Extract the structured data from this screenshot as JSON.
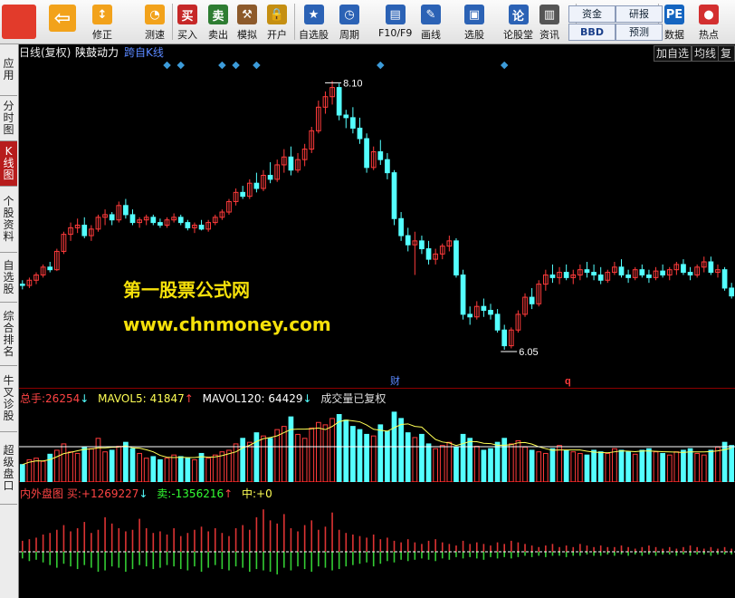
{
  "toolbar": {
    "buttons": [
      {
        "label": "",
        "icon": "grid-logo-icon",
        "color": "#e23b2b",
        "sym": ""
      },
      {
        "label": "",
        "icon": "back-arrow-icon",
        "color": "#f2a21b",
        "sym": "⇦"
      },
      {
        "label": "修正",
        "icon": "fix-icon",
        "color": "#f2a21b",
        "sym": "↕"
      },
      {
        "label": "测速",
        "icon": "speed-test-icon",
        "color": "#f2a21b",
        "sym": "◔"
      },
      {
        "label": "买入",
        "icon": "buy-icon",
        "color": "#c62828",
        "sym": "买"
      },
      {
        "label": "卖出",
        "icon": "sell-icon",
        "color": "#2e7d32",
        "sym": "卖"
      },
      {
        "label": "模拟",
        "icon": "simulate-icon",
        "color": "#8d5a2b",
        "sym": "⚒"
      },
      {
        "label": "开户",
        "icon": "lock-icon",
        "color": "#c58f12",
        "sym": "🔒"
      },
      {
        "label": "自选股",
        "icon": "star-watchlist-icon",
        "color": "#2b62b5",
        "sym": "★"
      },
      {
        "label": "周期",
        "icon": "period-icon",
        "color": "#2b62b5",
        "sym": "◷"
      },
      {
        "label": "F10/F9",
        "icon": "f10-info-icon",
        "color": "#2b62b5",
        "sym": "▤"
      },
      {
        "label": "画线",
        "icon": "draw-line-icon",
        "color": "#2b62b5",
        "sym": "✎"
      },
      {
        "label": "选股",
        "icon": "stock-picker-icon",
        "color": "#2b62b5",
        "sym": "▣"
      },
      {
        "label": "论股堂",
        "icon": "forum-icon",
        "color": "#2b62b5",
        "sym": "论"
      },
      {
        "label": "资讯",
        "icon": "news-icon",
        "color": "#555555",
        "sym": "▥"
      },
      {
        "label": "数据",
        "icon": "pe-data-icon",
        "color": "#1565c0",
        "sym": "PE"
      },
      {
        "label": "热点",
        "icon": "hot-icon",
        "color": "#d32f2f",
        "sym": "●"
      }
    ],
    "pills": [
      "资金",
      "研报",
      "BBD",
      "预测"
    ]
  },
  "sidebar": {
    "tabs": [
      {
        "label": "应用",
        "name": "sidebar-tab-apps"
      },
      {
        "label": "分时图",
        "name": "sidebar-tab-intraday"
      },
      {
        "label": "K线图",
        "name": "sidebar-tab-kline"
      },
      {
        "label": "个股资料",
        "name": "sidebar-tab-stock-profile"
      },
      {
        "label": "自选股",
        "name": "sidebar-tab-watchlist"
      },
      {
        "label": "综合排名",
        "name": "sidebar-tab-ranking"
      },
      {
        "label": "牛叉诊股",
        "name": "sidebar-tab-diagnosis"
      },
      {
        "label": "超级盘口",
        "name": "sidebar-tab-super-quote"
      }
    ],
    "active": 2
  },
  "chart_header": {
    "period": "日线(复权)",
    "stock_name": "陕鼓动力",
    "indicator": "跨自K线",
    "btn_add_watch": "加自选",
    "btn_ma": "均线",
    "btn_restore": "复权"
  },
  "annotations": {
    "high_label": "8.10",
    "low_label": "6.05",
    "cai_marker": "财",
    "q_marker": "q"
  },
  "volume_panel": {
    "total_label": "总手:",
    "total_value": "26254",
    "mavol5_label": "MAVOL5:",
    "mavol5_value": "41847",
    "mavol120_label": "MAVOL120:",
    "mavol120_value": "64429",
    "note": "成交量已复权"
  },
  "io_panel": {
    "title": "内外盘图",
    "buy_label": "买:",
    "buy_value": "+1269227",
    "sell_label": "卖:",
    "sell_value": "-1356216",
    "mid_label": "中:",
    "mid_value": "+0"
  },
  "watermark": {
    "line1": "第一股票公式网",
    "line2": "www.chnmoney.com"
  },
  "colors": {
    "up": "#ff3b3b",
    "down": "#54ffff",
    "up_dim": "#dd3333",
    "buy": "#dd3333",
    "sell": "#33cc33",
    "ma_white": "#ffffff",
    "ma_yellow": "#ffff55",
    "accent_header": "#5a88ff"
  },
  "chart_data": {
    "type": "candlestick",
    "candles": [
      [
        6.55,
        6.58,
        6.51,
        6.54
      ],
      [
        6.54,
        6.6,
        6.52,
        6.58
      ],
      [
        6.58,
        6.64,
        6.55,
        6.62
      ],
      [
        6.62,
        6.7,
        6.6,
        6.68
      ],
      [
        6.68,
        6.72,
        6.64,
        6.66
      ],
      [
        6.66,
        6.82,
        6.65,
        6.8
      ],
      [
        6.8,
        6.95,
        6.78,
        6.93
      ],
      [
        6.93,
        7.02,
        6.88,
        6.98
      ],
      [
        6.98,
        7.05,
        6.94,
        7.0
      ],
      [
        7.0,
        7.06,
        6.9,
        6.92
      ],
      [
        6.92,
        7.0,
        6.88,
        6.97
      ],
      [
        6.97,
        7.08,
        6.95,
        7.06
      ],
      [
        7.06,
        7.12,
        7.0,
        7.08
      ],
      [
        7.08,
        7.1,
        7.0,
        7.04
      ],
      [
        7.04,
        7.18,
        7.02,
        7.15
      ],
      [
        7.15,
        7.2,
        7.05,
        7.08
      ],
      [
        7.08,
        7.12,
        7.0,
        7.02
      ],
      [
        7.02,
        7.06,
        6.98,
        7.04
      ],
      [
        7.04,
        7.08,
        7.0,
        7.06
      ],
      [
        7.06,
        7.08,
        7.0,
        7.02
      ],
      [
        7.02,
        7.05,
        6.98,
        7.0
      ],
      [
        7.0,
        7.06,
        6.98,
        7.04
      ],
      [
        7.04,
        7.09,
        7.02,
        7.06
      ],
      [
        7.06,
        7.08,
        7.0,
        7.02
      ],
      [
        7.02,
        7.04,
        6.96,
        6.98
      ],
      [
        6.98,
        7.02,
        6.94,
        7.0
      ],
      [
        7.0,
        7.04,
        6.96,
        6.97
      ],
      [
        6.97,
        7.04,
        6.95,
        7.02
      ],
      [
        7.02,
        7.08,
        7.0,
        7.06
      ],
      [
        7.06,
        7.12,
        7.04,
        7.1
      ],
      [
        7.1,
        7.2,
        7.08,
        7.18
      ],
      [
        7.18,
        7.28,
        7.15,
        7.25
      ],
      [
        7.25,
        7.3,
        7.2,
        7.22
      ],
      [
        7.22,
        7.35,
        7.2,
        7.32
      ],
      [
        7.32,
        7.4,
        7.25,
        7.28
      ],
      [
        7.28,
        7.42,
        7.26,
        7.38
      ],
      [
        7.38,
        7.48,
        7.32,
        7.35
      ],
      [
        7.35,
        7.5,
        7.33,
        7.46
      ],
      [
        7.46,
        7.58,
        7.4,
        7.52
      ],
      [
        7.52,
        7.6,
        7.38,
        7.42
      ],
      [
        7.42,
        7.55,
        7.4,
        7.5
      ],
      [
        7.5,
        7.62,
        7.45,
        7.58
      ],
      [
        7.58,
        7.75,
        7.55,
        7.72
      ],
      [
        7.72,
        7.95,
        7.7,
        7.9
      ],
      [
        7.9,
        8.02,
        7.85,
        7.98
      ],
      [
        7.98,
        8.1,
        7.92,
        8.05
      ],
      [
        8.05,
        8.08,
        7.8,
        7.84
      ],
      [
        7.84,
        7.88,
        7.74,
        7.82
      ],
      [
        7.82,
        7.9,
        7.7,
        7.74
      ],
      [
        7.74,
        7.82,
        7.62,
        7.66
      ],
      [
        7.66,
        7.7,
        7.4,
        7.44
      ],
      [
        7.44,
        7.6,
        7.42,
        7.56
      ],
      [
        7.56,
        7.65,
        7.46,
        7.5
      ],
      [
        7.5,
        7.55,
        7.35,
        7.4
      ],
      [
        7.4,
        7.42,
        7.0,
        7.05
      ],
      [
        7.05,
        7.1,
        6.88,
        6.92
      ],
      [
        6.92,
        6.98,
        6.8,
        6.85
      ],
      [
        6.85,
        6.95,
        6.62,
        6.88
      ],
      [
        6.88,
        6.92,
        6.78,
        6.82
      ],
      [
        6.82,
        6.88,
        6.7,
        6.74
      ],
      [
        6.74,
        6.82,
        6.7,
        6.78
      ],
      [
        6.78,
        6.86,
        6.74,
        6.84
      ],
      [
        6.84,
        6.92,
        6.8,
        6.88
      ],
      [
        6.88,
        6.9,
        6.6,
        6.62
      ],
      [
        6.62,
        6.66,
        6.28,
        6.32
      ],
      [
        6.32,
        6.38,
        6.24,
        6.3
      ],
      [
        6.3,
        6.42,
        6.28,
        6.38
      ],
      [
        6.38,
        6.44,
        6.3,
        6.35
      ],
      [
        6.35,
        6.4,
        6.28,
        6.32
      ],
      [
        6.32,
        6.36,
        6.18,
        6.2
      ],
      [
        6.2,
        6.24,
        6.05,
        6.08
      ],
      [
        6.08,
        6.22,
        6.06,
        6.2
      ],
      [
        6.2,
        6.35,
        6.18,
        6.32
      ],
      [
        6.32,
        6.48,
        6.3,
        6.45
      ],
      [
        6.45,
        6.52,
        6.36,
        6.4
      ],
      [
        6.4,
        6.58,
        6.38,
        6.55
      ],
      [
        6.55,
        6.66,
        6.5,
        6.62
      ],
      [
        6.62,
        6.7,
        6.56,
        6.6
      ],
      [
        6.6,
        6.68,
        6.55,
        6.64
      ],
      [
        6.64,
        6.7,
        6.58,
        6.6
      ],
      [
        6.6,
        6.66,
        6.55,
        6.62
      ],
      [
        6.62,
        6.7,
        6.58,
        6.66
      ],
      [
        6.66,
        6.72,
        6.6,
        6.64
      ],
      [
        6.64,
        6.7,
        6.58,
        6.62
      ],
      [
        6.62,
        6.68,
        6.55,
        6.58
      ],
      [
        6.58,
        6.66,
        6.56,
        6.64
      ],
      [
        6.64,
        6.72,
        6.62,
        6.68
      ],
      [
        6.68,
        6.74,
        6.6,
        6.62
      ],
      [
        6.62,
        6.66,
        6.56,
        6.6
      ],
      [
        6.6,
        6.68,
        6.58,
        6.66
      ],
      [
        6.66,
        6.7,
        6.6,
        6.62
      ],
      [
        6.62,
        6.66,
        6.56,
        6.6
      ],
      [
        6.6,
        6.68,
        6.58,
        6.65
      ],
      [
        6.65,
        6.7,
        6.6,
        6.62
      ],
      [
        6.62,
        6.68,
        6.58,
        6.66
      ],
      [
        6.66,
        6.72,
        6.62,
        6.7
      ],
      [
        6.7,
        6.74,
        6.62,
        6.64
      ],
      [
        6.64,
        6.68,
        6.58,
        6.62
      ],
      [
        6.62,
        6.7,
        6.6,
        6.68
      ],
      [
        6.68,
        6.76,
        6.64,
        6.72
      ],
      [
        6.72,
        6.76,
        6.62,
        6.64
      ],
      [
        6.64,
        6.7,
        6.6,
        6.66
      ],
      [
        6.66,
        6.68,
        6.5,
        6.52
      ],
      [
        6.52,
        6.56,
        6.44,
        6.46
      ]
    ],
    "volume": [
      22,
      28,
      30,
      26,
      35,
      40,
      48,
      38,
      36,
      44,
      42,
      55,
      38,
      40,
      45,
      50,
      42,
      36,
      30,
      32,
      28,
      30,
      34,
      32,
      30,
      28,
      36,
      30,
      34,
      38,
      40,
      48,
      55,
      50,
      62,
      58,
      55,
      66,
      70,
      82,
      60,
      55,
      68,
      75,
      72,
      80,
      85,
      78,
      70,
      66,
      60,
      58,
      72,
      64,
      88,
      80,
      62,
      56,
      60,
      48,
      42,
      46,
      50,
      44,
      60,
      55,
      45,
      40,
      42,
      50,
      55,
      48,
      52,
      44,
      40,
      38,
      36,
      42,
      46,
      40,
      38,
      36,
      34,
      40,
      38,
      36,
      42,
      40,
      38,
      35,
      40,
      42,
      38,
      36,
      34,
      38,
      40,
      42,
      36,
      34,
      40,
      44,
      50,
      46
    ],
    "io_buy": [
      14,
      16,
      18,
      22,
      24,
      28,
      34,
      26,
      30,
      38,
      24,
      28,
      44,
      36,
      30,
      26,
      28,
      42,
      30,
      24,
      26,
      22,
      30,
      20,
      24,
      28,
      32,
      26,
      30,
      24,
      20,
      30,
      34,
      28,
      44,
      54,
      40,
      36,
      48,
      30,
      26,
      34,
      40,
      28,
      32,
      50,
      28,
      24,
      22,
      20,
      18,
      22,
      16,
      18,
      14,
      12,
      16,
      12,
      10,
      14,
      16,
      12,
      10,
      8,
      14,
      10,
      12,
      10,
      8,
      12,
      10,
      14,
      12,
      10,
      8,
      6,
      8,
      10,
      6,
      8,
      6,
      10,
      8,
      6,
      8,
      6,
      6,
      8,
      6,
      4,
      6,
      8,
      6,
      4,
      6,
      4,
      6,
      8,
      6,
      4,
      6,
      4,
      6,
      4
    ],
    "io_sell": [
      10,
      14,
      12,
      16,
      20,
      24,
      18,
      22,
      26,
      20,
      24,
      30,
      28,
      22,
      24,
      30,
      26,
      20,
      22,
      26,
      24,
      20,
      22,
      26,
      28,
      22,
      30,
      24,
      20,
      26,
      28,
      22,
      24,
      30,
      26,
      28,
      30,
      34,
      24,
      28,
      22,
      26,
      30,
      22,
      24,
      28,
      26,
      22,
      20,
      18,
      16,
      22,
      18,
      14,
      16,
      12,
      14,
      12,
      10,
      12,
      14,
      10,
      12,
      8,
      10,
      8,
      10,
      12,
      8,
      10,
      8,
      10,
      8,
      6,
      8,
      6,
      8,
      6,
      6,
      8,
      6,
      6,
      4,
      6,
      6,
      4,
      6,
      4,
      6,
      4,
      6,
      4,
      6,
      4,
      4,
      6,
      4,
      6,
      4,
      4,
      6,
      4,
      4,
      4
    ],
    "price_range": [
      5.78,
      8.22
    ]
  }
}
